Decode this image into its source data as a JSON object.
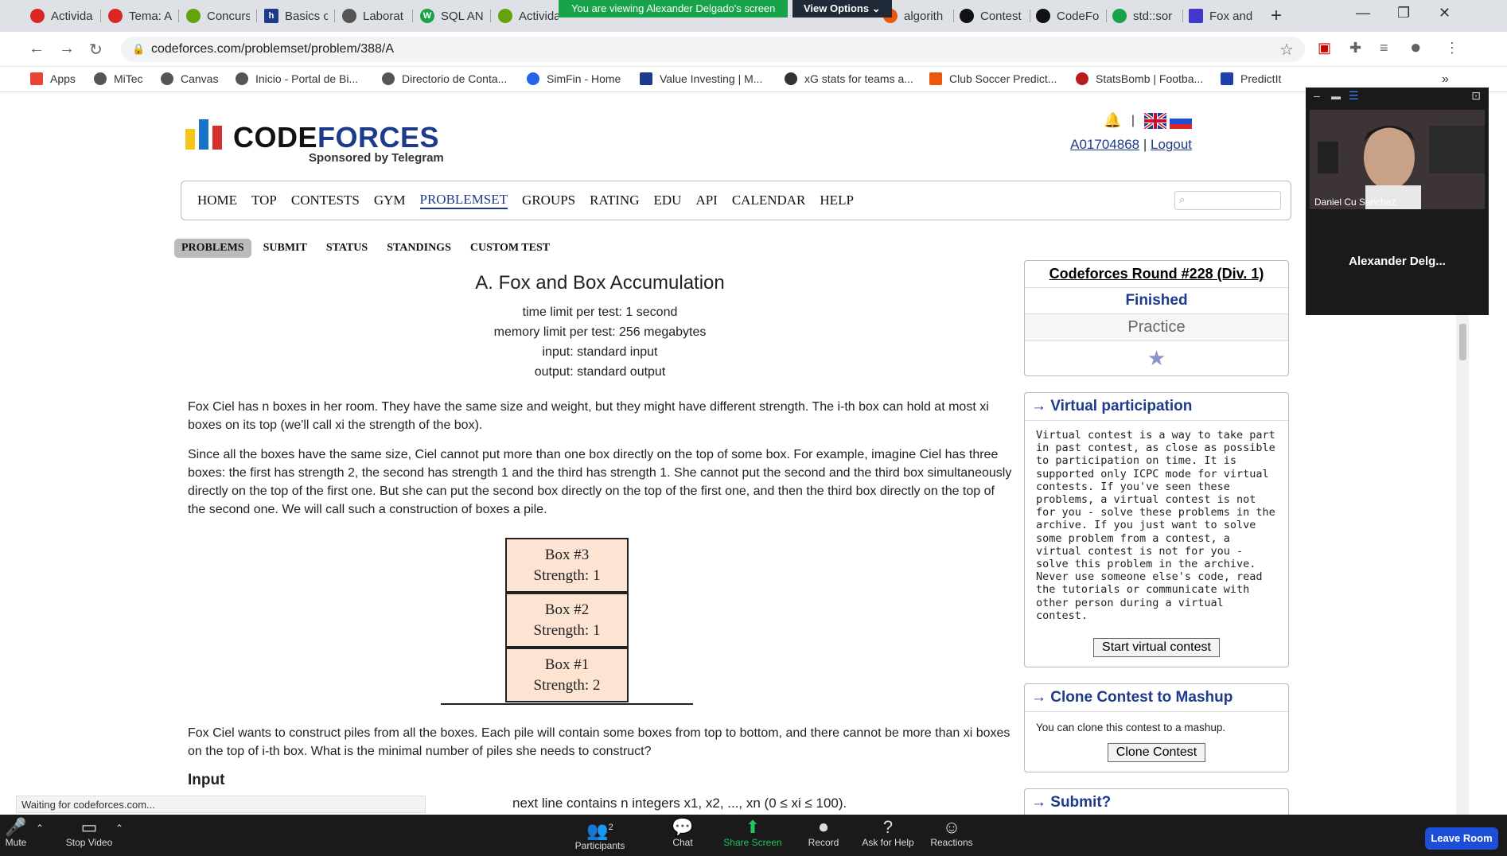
{
  "browser": {
    "tabs": [
      {
        "label": "Activida",
        "color": "#dc2626"
      },
      {
        "label": "Tema: A",
        "color": "#dc2626"
      },
      {
        "label": "Concurs",
        "color": "#65a30d"
      },
      {
        "label": "Basics o",
        "color": "#1e3a8a"
      },
      {
        "label": "Laborat",
        "color": "#555555"
      },
      {
        "label": "SQL AN",
        "color": "#16a34a"
      },
      {
        "label": "Activida",
        "color": "#65a30d"
      },
      {
        "label": "algorith",
        "color": "#ea580c"
      },
      {
        "label": "Contest",
        "color": "#111111"
      },
      {
        "label": "CodeFo",
        "color": "#111111"
      },
      {
        "label": "std::sor",
        "color": "#16a34a"
      },
      {
        "label": "Fox and",
        "color": "#4338ca"
      }
    ],
    "new_tab": "+",
    "url": "codeforces.com/problemset/problem/388/A",
    "bookmarks": [
      {
        "label": "Apps",
        "color": "#ea4335"
      },
      {
        "label": "MiTec",
        "color": "#555555"
      },
      {
        "label": "Canvas",
        "color": "#555555"
      },
      {
        "label": "Inicio - Portal de Bi...",
        "color": "#555555"
      },
      {
        "label": "Directorio de Conta...",
        "color": "#555555"
      },
      {
        "label": "SimFin - Home",
        "color": "#2563eb"
      },
      {
        "label": "Value Investing | M...",
        "color": "#1e3a8a"
      },
      {
        "label": "xG stats for teams a...",
        "color": "#333333"
      },
      {
        "label": "Club Soccer Predict...",
        "color": "#ea580c"
      },
      {
        "label": "StatsBomb | Footba...",
        "color": "#b91c1c"
      },
      {
        "label": "PredictIt",
        "color": "#1e40af"
      }
    ],
    "more_bookmarks": "»",
    "status": "Waiting for codeforces.com..."
  },
  "zoom_banner": {
    "viewing": "You are viewing Alexander Delgado's screen",
    "view_options": "View Options ⌄"
  },
  "header": {
    "logo_code": "CODE",
    "logo_forces": "FORCES",
    "sponsor": "Sponsored by Telegram",
    "user": "A01704868",
    "separator": "|",
    "logout": "Logout"
  },
  "nav": {
    "items": [
      "HOME",
      "TOP",
      "CONTESTS",
      "GYM",
      "PROBLEMSET",
      "GROUPS",
      "RATING",
      "EDU",
      "API",
      "CALENDAR",
      "HELP"
    ],
    "active": "PROBLEMSET"
  },
  "subnav": [
    "PROBLEMS",
    "SUBMIT",
    "STATUS",
    "STANDINGS",
    "CUSTOM TEST"
  ],
  "problem": {
    "title": "A. Fox and Box Accumulation",
    "time_limit": "time limit per test: 1 second",
    "memory_limit": "memory limit per test: 256 megabytes",
    "input": "input: standard input",
    "output": "output: standard output",
    "p1": "Fox Ciel has n boxes in her room. They have the same size and weight, but they might have different strength. The i-th box can hold at most xi boxes on its top (we'll call xi the strength of the box).",
    "p2": "Since all the boxes have the same size, Ciel cannot put more than one box directly on the top of some box. For example, imagine Ciel has three boxes: the first has strength 2, the second has strength 1 and the third has strength 1. She cannot put the second and the third box simultaneously directly on the top of the first one. But she can put the second box directly on the top of the first one, and then the third box directly on the top of the second one. We will call such a construction of boxes a pile.",
    "boxes": [
      {
        "name": "Box #3",
        "strength": "Strength: 1"
      },
      {
        "name": "Box #2",
        "strength": "Strength: 1"
      },
      {
        "name": "Box #1",
        "strength": "Strength: 2"
      }
    ],
    "p3": "Fox Ciel wants to construct piles from all the boxes. Each pile will contain some boxes from top to bottom, and there cannot be more than xi boxes on the top of i-th box. What is the minimal number of piles she needs to construct?",
    "input_heading": "Input",
    "input_line": "next line contains n integers x1, x2, ..., xn (0 ≤ xi ≤ 100)."
  },
  "sidebar": {
    "round_title": "Codeforces Round #228 (Div. 1)",
    "round_status": "Finished",
    "round_phase": "Practice",
    "star": "★",
    "virtual_title": "→ Virtual participation",
    "virtual_text": "Virtual contest is a way to take part in past contest, as close as possible to participation on time. It is supported only ICPC mode for virtual contests. If you've seen these problems, a virtual contest is not for you - solve these problems in the archive. If you just want to solve some problem from a contest, a virtual contest is not for you - solve this problem in the archive. Never use someone else's code, read the tutorials or communicate with other person during a virtual contest.",
    "virtual_button": "Start virtual contest",
    "clone_title": "→ Clone Contest to Mashup",
    "clone_text": "You can clone this contest to a mashup.",
    "clone_button": "Clone Contest",
    "submit_title": "→ Submit?"
  },
  "zoom": {
    "participant_video": "Daniel Cu Sanchez",
    "participant_other": "Alexander  Delg...",
    "controls": [
      {
        "label": "Mute",
        "icon": "🎤"
      },
      {
        "label": "Stop Video",
        "icon": "▭"
      },
      {
        "label": "Participants",
        "icon": "👥",
        "count": "2"
      },
      {
        "label": "Chat",
        "icon": "💬"
      },
      {
        "label": "Share Screen",
        "icon": "⬆"
      },
      {
        "label": "Record",
        "icon": "⏺"
      },
      {
        "label": "Ask for Help",
        "icon": "?"
      },
      {
        "label": "Reactions",
        "icon": "☺"
      }
    ],
    "leave": "Leave Room"
  }
}
